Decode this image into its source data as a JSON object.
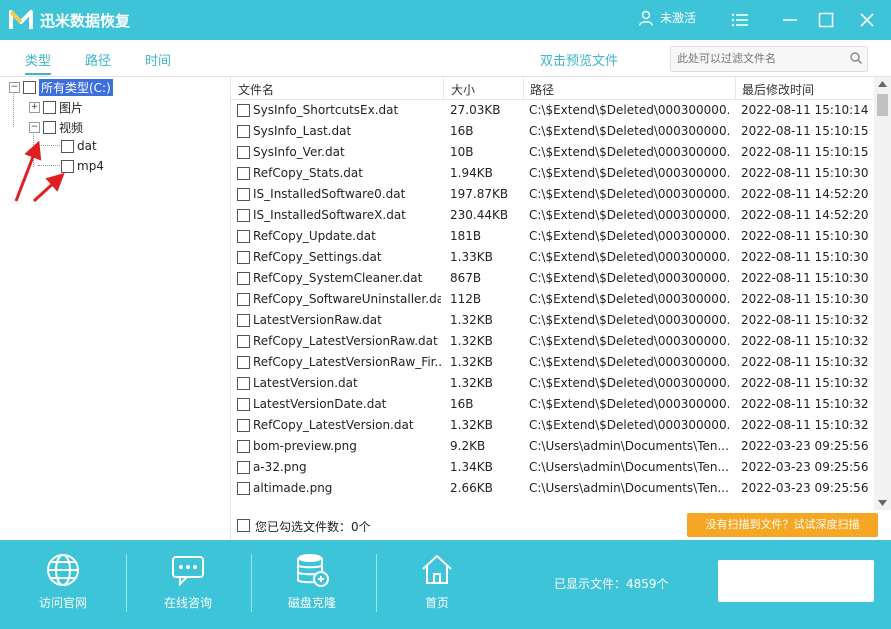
{
  "window": {
    "title": "迅米数据恢复",
    "user_status": "未激活"
  },
  "tabs": [
    {
      "label": "类型"
    },
    {
      "label": "路径"
    },
    {
      "label": "时间"
    }
  ],
  "preview_link": "双击预览文件",
  "filter": {
    "placeholder": "此处可以过滤文件名"
  },
  "tree": {
    "root": "所有类型(C:)",
    "images": "图片",
    "videos": "视频",
    "dat": "dat",
    "mp4": "mp4"
  },
  "columns": [
    "文件名",
    "大小",
    "路径",
    "最后修改时间"
  ],
  "files": [
    {
      "name": "SysInfo_ShortcutsEx.dat",
      "size": "27.03KB",
      "path": "C:\\$Extend\\$Deleted\\000300000...",
      "modified": "2022-08-11 15:10:14"
    },
    {
      "name": "SysInfo_Last.dat",
      "size": "16B",
      "path": "C:\\$Extend\\$Deleted\\000300000...",
      "modified": "2022-08-11 15:10:15"
    },
    {
      "name": "SysInfo_Ver.dat",
      "size": "10B",
      "path": "C:\\$Extend\\$Deleted\\000300000...",
      "modified": "2022-08-11 15:10:15"
    },
    {
      "name": "RefCopy_Stats.dat",
      "size": "1.94KB",
      "path": "C:\\$Extend\\$Deleted\\000300000...",
      "modified": "2022-08-11 15:10:30"
    },
    {
      "name": "IS_InstalledSoftware0.dat",
      "size": "197.87KB",
      "path": "C:\\$Extend\\$Deleted\\000300000...",
      "modified": "2022-08-11 14:52:20"
    },
    {
      "name": "IS_InstalledSoftwareX.dat",
      "size": "230.44KB",
      "path": "C:\\$Extend\\$Deleted\\000300000...",
      "modified": "2022-08-11 14:52:20"
    },
    {
      "name": "RefCopy_Update.dat",
      "size": "181B",
      "path": "C:\\$Extend\\$Deleted\\000300000...",
      "modified": "2022-08-11 15:10:30"
    },
    {
      "name": "RefCopy_Settings.dat",
      "size": "1.33KB",
      "path": "C:\\$Extend\\$Deleted\\000300000...",
      "modified": "2022-08-11 15:10:30"
    },
    {
      "name": "RefCopy_SystemCleaner.dat",
      "size": "867B",
      "path": "C:\\$Extend\\$Deleted\\000300000...",
      "modified": "2022-08-11 15:10:30"
    },
    {
      "name": "RefCopy_SoftwareUninstaller.dat",
      "size": "112B",
      "path": "C:\\$Extend\\$Deleted\\000300000...",
      "modified": "2022-08-11 15:10:30"
    },
    {
      "name": "LatestVersionRaw.dat",
      "size": "1.32KB",
      "path": "C:\\$Extend\\$Deleted\\000300000...",
      "modified": "2022-08-11 15:10:32"
    },
    {
      "name": "RefCopy_LatestVersionRaw.dat",
      "size": "1.32KB",
      "path": "C:\\$Extend\\$Deleted\\000300000...",
      "modified": "2022-08-11 15:10:32"
    },
    {
      "name": "RefCopy_LatestVersionRaw_Fir...",
      "size": "1.32KB",
      "path": "C:\\$Extend\\$Deleted\\000300000...",
      "modified": "2022-08-11 15:10:32"
    },
    {
      "name": "LatestVersion.dat",
      "size": "1.32KB",
      "path": "C:\\$Extend\\$Deleted\\000300000...",
      "modified": "2022-08-11 15:10:32"
    },
    {
      "name": "LatestVersionDate.dat",
      "size": "16B",
      "path": "C:\\$Extend\\$Deleted\\000300000...",
      "modified": "2022-08-11 15:10:32"
    },
    {
      "name": "RefCopy_LatestVersion.dat",
      "size": "1.32KB",
      "path": "C:\\$Extend\\$Deleted\\000300000...",
      "modified": "2022-08-11 15:10:32"
    },
    {
      "name": "bom-preview.png",
      "size": "9.2KB",
      "path": "C:\\Users\\admin\\Documents\\Ten...",
      "modified": "2022-03-23 09:25:56"
    },
    {
      "name": "a-32.png",
      "size": "1.34KB",
      "path": "C:\\Users\\admin\\Documents\\Ten...",
      "modified": "2022-03-23 09:25:56"
    },
    {
      "name": "altimade.png",
      "size": "2.66KB",
      "path": "C:\\Users\\admin\\Documents\\Ten...",
      "modified": "2022-03-23 09:25:56"
    }
  ],
  "selection": {
    "label": "您已勾选文件数：0个"
  },
  "deep_scan_button": "没有扫描到文件？试试深度扫描",
  "bottom_nav": [
    {
      "label": "访问官网",
      "icon": "globe-icon"
    },
    {
      "label": "在线咨询",
      "icon": "chat-icon"
    },
    {
      "label": "磁盘克隆",
      "icon": "disk-clone-icon"
    },
    {
      "label": "首页",
      "icon": "home-icon"
    }
  ],
  "shown_files": "已显示文件：4859个",
  "colors": {
    "accent": "#3dc4d9",
    "scan_button": "#f5a623",
    "tree_selected": "#3b6fdc"
  }
}
